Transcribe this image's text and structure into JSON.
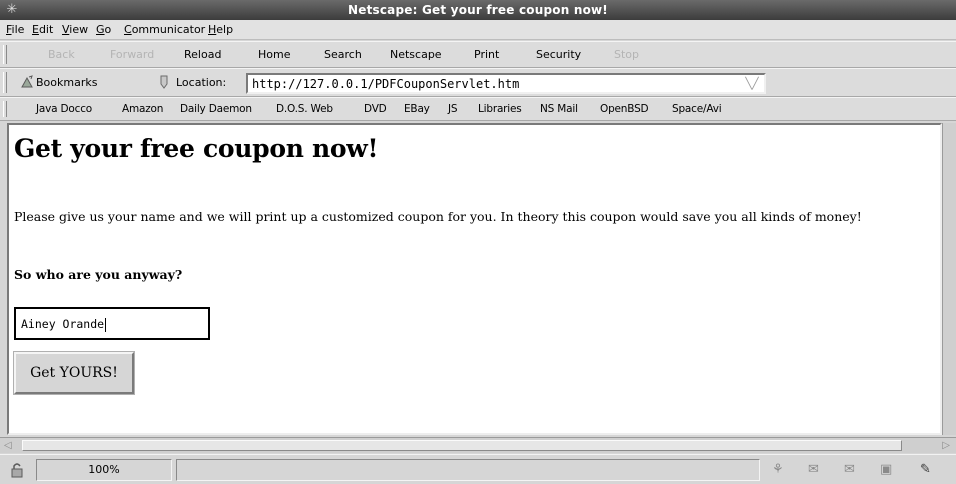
{
  "window": {
    "title": "Netscape: Get your free coupon now!"
  },
  "menubar": {
    "items": [
      {
        "acc": "F",
        "rest": "ile"
      },
      {
        "acc": "E",
        "rest": "dit"
      },
      {
        "acc": "V",
        "rest": "iew"
      },
      {
        "acc": "G",
        "rest": "o"
      },
      {
        "acc": "C",
        "rest": "ommunicator"
      },
      {
        "acc": "H",
        "rest": "elp"
      }
    ]
  },
  "nav_toolbar": {
    "back": "Back",
    "forward": "Forward",
    "reload": "Reload",
    "home": "Home",
    "search": "Search",
    "netscape": "Netscape",
    "print": "Print",
    "security": "Security",
    "stop": "Stop"
  },
  "location_toolbar": {
    "bookmarks_label": "Bookmarks",
    "location_label": "Location:",
    "url": "http://127.0.0.1/PDFCouponServlet.htm"
  },
  "personal_toolbar": {
    "items": [
      "Java Docco",
      "Amazon",
      "Daily Daemon",
      "D.O.S. Web",
      "DVD",
      "EBay",
      "JS",
      "Libraries",
      "NS Mail",
      "OpenBSD",
      "Space/Avi"
    ]
  },
  "page": {
    "heading": "Get your free coupon now!",
    "intro": "Please give us your name and we will print up a customized coupon for you. In theory this coupon would save you all kinds of money!",
    "question": "So who are you anyway?",
    "name_value": "Ainey Orande",
    "submit_label": "Get YOURS!"
  },
  "statusbar": {
    "zoom": "100%"
  }
}
